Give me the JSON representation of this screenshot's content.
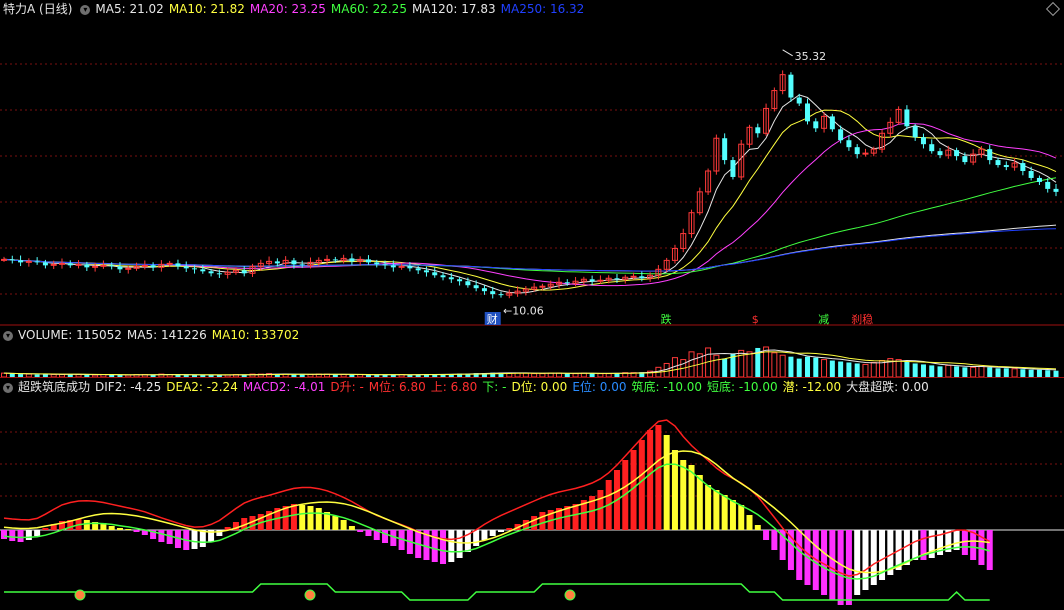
{
  "main_legend": {
    "stock_name": "特力A (日线)",
    "items": [
      {
        "label": "MA5: 21.02",
        "color": "#e6e6e6"
      },
      {
        "label": "MA10: 21.82",
        "color": "#ffff40"
      },
      {
        "label": "MA20: 23.25",
        "color": "#ff40ff"
      },
      {
        "label": "MA60: 22.25",
        "color": "#40ff40"
      },
      {
        "label": "MA120: 17.83",
        "color": "#e6e6e6"
      },
      {
        "label": "MA250: 16.32",
        "color": "#2040ff"
      }
    ]
  },
  "vol_legend": {
    "items": [
      {
        "label": "VOLUME: 115052",
        "color": "#e6e6e6"
      },
      {
        "label": "MA5: 141226",
        "color": "#e6e6e6"
      },
      {
        "label": "MA10: 133702",
        "color": "#ffff40"
      }
    ]
  },
  "ind_legend": {
    "items": [
      {
        "label": "超跌筑底成功",
        "color": "#e6e6e6"
      },
      {
        "label": "DIF2: -4.25",
        "color": "#e6e6e6"
      },
      {
        "label": "DEA2: -2.24",
        "color": "#ffff40"
      },
      {
        "label": "MACD2: -4.01",
        "color": "#ff40ff"
      },
      {
        "label": "D升: -",
        "color": "#ff3030"
      },
      {
        "label": "M位: 6.80",
        "color": "#ff3030"
      },
      {
        "label": "上: 6.80",
        "color": "#ff3030"
      },
      {
        "label": "下: -",
        "color": "#40ff40"
      },
      {
        "label": "D位: 0.00",
        "color": "#ffff40"
      },
      {
        "label": "E位: 0.00",
        "color": "#2a8cff"
      },
      {
        "label": "筑底: -10.00",
        "color": "#40ff40"
      },
      {
        "label": "短底: -10.00",
        "color": "#40ff40"
      },
      {
        "label": "潜: -12.00",
        "color": "#ffff40"
      },
      {
        "label": "大盘超跌: 0.00",
        "color": "#e6e6e6"
      }
    ]
  },
  "chart_data": [
    {
      "type": "candlestick",
      "title": "特力A (日线)",
      "ylim": [
        8.5,
        37.5
      ],
      "annotations": {
        "high": "35.32",
        "low": "10.06"
      },
      "markers": [
        {
          "text": "财",
          "color": "#ffffff"
        },
        {
          "text": "跌",
          "color": "#40ff40"
        },
        {
          "text": "$",
          "color": "#ff3030"
        },
        {
          "text": "减",
          "color": "#40ff40"
        },
        {
          "text": "刹稳",
          "color": "#ff3030"
        }
      ],
      "close": [
        14.2,
        14.1,
        13.9,
        14.0,
        13.9,
        13.6,
        13.7,
        13.8,
        13.6,
        13.7,
        13.4,
        13.5,
        13.6,
        13.5,
        13.2,
        13.3,
        13.5,
        13.6,
        13.4,
        13.7,
        13.8,
        13.5,
        13.3,
        13.2,
        13.0,
        12.8,
        12.7,
        12.9,
        13.1,
        12.8,
        13.5,
        13.8,
        14.0,
        13.8,
        14.1,
        13.7,
        13.6,
        13.9,
        14.1,
        14.2,
        14.1,
        14.3,
        14.0,
        14.2,
        13.9,
        13.7,
        13.6,
        13.4,
        13.5,
        13.3,
        13.1,
        12.9,
        12.6,
        12.4,
        12.2,
        12.0,
        11.6,
        11.3,
        11.0,
        10.7,
        10.6,
        10.8,
        11.0,
        11.2,
        11.4,
        11.5,
        11.7,
        11.9,
        11.8,
        12.0,
        12.2,
        12.0,
        12.1,
        12.3,
        12.2,
        12.4,
        12.5,
        12.3,
        12.6,
        13.2,
        14.1,
        15.3,
        16.8,
        18.9,
        21.0,
        23.1,
        26.4,
        24.2,
        22.5,
        25.8,
        27.5,
        26.9,
        29.4,
        31.2,
        32.8,
        30.5,
        29.9,
        28.1,
        27.4,
        28.6,
        27.3,
        26.2,
        25.5,
        24.8,
        24.9,
        25.3,
        26.9,
        28.0,
        29.3,
        27.6,
        26.5,
        25.8,
        25.1,
        24.7,
        25.2,
        24.6,
        24.0,
        24.8,
        25.3,
        24.2,
        23.7,
        23.5,
        23.9,
        23.1,
        22.4,
        22.0,
        21.3,
        21.0
      ]
    },
    {
      "type": "bar",
      "title": "VOLUME",
      "series": [
        {
          "name": "VOLUME",
          "values": [
            8,
            7,
            6,
            6,
            5,
            6,
            5,
            5,
            6,
            5,
            5,
            4,
            5,
            5,
            4,
            4,
            5,
            5,
            5,
            6,
            5,
            5,
            4,
            4,
            4,
            5,
            4,
            4,
            5,
            5,
            6,
            6,
            7,
            6,
            6,
            5,
            5,
            5,
            6,
            6,
            5,
            5,
            5,
            5,
            4,
            4,
            5,
            5,
            5,
            5,
            5,
            6,
            5,
            6,
            6,
            7,
            7,
            8,
            8,
            9,
            9,
            8,
            8,
            8,
            7,
            7,
            8,
            8,
            7,
            7,
            8,
            8,
            7,
            7,
            8,
            9,
            9,
            10,
            12,
            20,
            28,
            40,
            36,
            52,
            48,
            60,
            45,
            38,
            48,
            55,
            52,
            60,
            62,
            50,
            45,
            42,
            38,
            42,
            40,
            36,
            34,
            32,
            30,
            28,
            26,
            30,
            34,
            38,
            36,
            32,
            28,
            26,
            24,
            22,
            24,
            22,
            20,
            20,
            22,
            20,
            18,
            18,
            17,
            16,
            15,
            15,
            14,
            13
          ]
        }
      ]
    },
    {
      "type": "bar",
      "title": "超跌筑底成功",
      "series": [
        {
          "name": "MACD2",
          "values": [
            -0.9,
            -1.1,
            -1.2,
            -1.0,
            -0.6,
            0.2,
            0.6,
            0.9,
            1.0,
            1.1,
            1.0,
            0.8,
            0.7,
            0.4,
            0.2,
            0.1,
            -0.2,
            -0.5,
            -0.9,
            -1.2,
            -1.4,
            -1.8,
            -2.0,
            -1.9,
            -1.7,
            -1.2,
            -0.6,
            0.3,
            0.8,
            1.2,
            1.4,
            1.6,
            1.9,
            2.2,
            2.4,
            2.6,
            2.5,
            2.4,
            2.2,
            1.8,
            1.4,
            1.0,
            0.4,
            -0.2,
            -0.6,
            -1.0,
            -1.3,
            -1.6,
            -2.0,
            -2.4,
            -2.8,
            -3.0,
            -3.2,
            -3.4,
            -3.2,
            -2.8,
            -2.2,
            -1.6,
            -1.0,
            -0.6,
            -0.2,
            0.2,
            0.6,
            1.0,
            1.4,
            1.8,
            2.0,
            2.2,
            2.4,
            2.6,
            3.0,
            3.4,
            4.0,
            5.0,
            6.0,
            7.0,
            8.0,
            9.0,
            10.0,
            10.5,
            9.5,
            8.0,
            7.0,
            6.5,
            5.5,
            4.5,
            4.0,
            3.5,
            3.0,
            2.5,
            1.5,
            0.5,
            -1.0,
            -2.0,
            -3.0,
            -4.0,
            -5.0,
            -5.5,
            -6.0,
            -6.5,
            -7.0,
            -7.5,
            -7.5,
            -6.5,
            -6.0,
            -5.5,
            -5.0,
            -4.5,
            -4.0,
            -3.5,
            -3.0,
            -3.0,
            -2.8,
            -2.5,
            -2.2,
            -2.0,
            -2.5,
            -3.0,
            -3.5,
            -4.0
          ]
        }
      ]
    }
  ]
}
